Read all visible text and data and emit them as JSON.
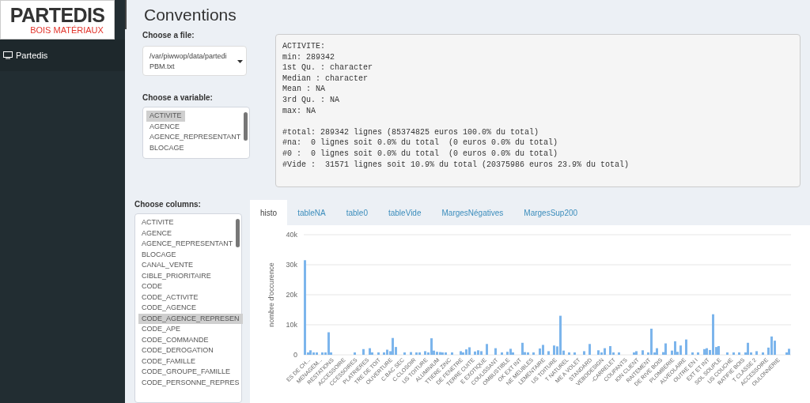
{
  "logo": {
    "brand": "PARTEDIS",
    "tagline": "BOIS MATÉRIAUX"
  },
  "sidebar": {
    "items": [
      {
        "label": "Partedis",
        "selected": true
      }
    ]
  },
  "page": {
    "title": "Conventions"
  },
  "file_select": {
    "label": "Choose a file:",
    "value_lines": [
      "/var/piwwop/data/partedi",
      "PBM.txt"
    ]
  },
  "variable_list": {
    "label": "Choose a variable:",
    "items": [
      {
        "label": "ACTIVITE",
        "selected": true
      },
      {
        "label": "AGENCE",
        "selected": false
      },
      {
        "label": "AGENCE_REPRESENTANT",
        "selected": false
      },
      {
        "label": "BLOCAGE",
        "selected": false
      }
    ]
  },
  "columns_list": {
    "label": "Choose columns:",
    "items": [
      {
        "label": "ACTIVITE",
        "selected": false
      },
      {
        "label": "AGENCE",
        "selected": false
      },
      {
        "label": "AGENCE_REPRESENTANT",
        "selected": false
      },
      {
        "label": "BLOCAGE",
        "selected": false
      },
      {
        "label": "CANAL_VENTE",
        "selected": false
      },
      {
        "label": "CIBLE_PRIORITAIRE",
        "selected": false
      },
      {
        "label": "CODE",
        "selected": false
      },
      {
        "label": "CODE_ACTIVITE",
        "selected": false
      },
      {
        "label": "CODE_AGENCE",
        "selected": false
      },
      {
        "label": "CODE_AGENCE_REPRESEN",
        "selected": true
      },
      {
        "label": "CODE_APE",
        "selected": false
      },
      {
        "label": "CODE_COMMANDE",
        "selected": false
      },
      {
        "label": "CODE_DEROGATION",
        "selected": false
      },
      {
        "label": "CODE_FAMILLE",
        "selected": false
      },
      {
        "label": "CODE_GROUPE_FAMILLE",
        "selected": false
      },
      {
        "label": "CODE_PERSONNE_REPRES",
        "selected": false
      }
    ]
  },
  "summary_output": {
    "stats": [
      "ACTIVITE:",
      "min: 289342",
      "1st Qu. : character",
      "Median : character",
      "Mean : NA",
      "3rd Qu. : NA",
      "max: NA"
    ],
    "totals": [
      "#total: 289342 lignes (85374825 euros 100.0% du total)",
      "#na:  0 lignes soit 0.0% du total  (0 euros 0.0% du total)",
      "#0 :  0 lignes soit 0.0% du total  (0 euros 0.0% du total)",
      "#Vide :  31571 lignes soit 10.9% du total (20375986 euros 23.9% du total)"
    ]
  },
  "tabs": [
    {
      "label": "histo",
      "selected": true
    },
    {
      "label": "tableNA",
      "selected": false
    },
    {
      "label": "table0",
      "selected": false
    },
    {
      "label": "tableVide",
      "selected": false
    },
    {
      "label": "MargesNégatives",
      "selected": false
    },
    {
      "label": "MargesSup200",
      "selected": false
    }
  ],
  "chart_data": {
    "type": "bar",
    "grid": true,
    "ylabel": "nombre d'occurence",
    "ylim": [
      0,
      40000
    ],
    "yticks": [
      {
        "value": 0,
        "label": "0"
      },
      {
        "value": 10000,
        "label": "10k"
      },
      {
        "value": 20000,
        "label": "20k"
      },
      {
        "value": 30000,
        "label": "30k"
      },
      {
        "value": 40000,
        "label": "40k"
      }
    ],
    "series": [
      {
        "color": "#7cb5ec",
        "values": [
          31500,
          800,
          1500,
          800,
          800,
          0,
          800,
          800,
          7500,
          800,
          0,
          0,
          0,
          0,
          0,
          0,
          0,
          800,
          0,
          0,
          1900,
          0,
          2200,
          800,
          0,
          800,
          0,
          800,
          1700,
          1200,
          5600,
          2600,
          0,
          0,
          800,
          0,
          900,
          0,
          800,
          800,
          0,
          1200,
          800,
          5500,
          1400,
          1000,
          900,
          800,
          800,
          0,
          800,
          0,
          0,
          1200,
          800,
          1800,
          2500,
          0,
          1100,
          1500,
          1200,
          0,
          3600,
          0,
          0,
          2200,
          0,
          800,
          0,
          1000,
          2000,
          800,
          0,
          0,
          4000,
          900,
          800,
          0,
          800,
          0,
          2100,
          3300,
          0,
          1200,
          0,
          3100,
          2800,
          13000,
          1400,
          0,
          800,
          0,
          800,
          0,
          0,
          1200,
          0,
          3600,
          0,
          0,
          1500,
          800,
          2200,
          0,
          2900,
          800,
          0,
          800,
          0,
          0,
          0,
          0,
          800,
          1200,
          0,
          1500,
          0,
          800,
          8700,
          800,
          2200,
          0,
          900,
          3800,
          0,
          1400,
          4500,
          1000,
          3100,
          0,
          5100,
          0,
          800,
          0,
          800,
          0,
          1900,
          2200,
          1600,
          13500,
          2600,
          2900,
          0,
          0,
          800,
          0,
          800,
          0,
          800,
          0,
          800,
          4000,
          800,
          0,
          1200,
          0,
          800,
          0,
          2400,
          6100,
          4700,
          0,
          0,
          0,
          800,
          2000
        ]
      }
    ],
    "categories": [
      null,
      "ES DE CH...",
      null,
      null,
      null,
      "MENAGEM...",
      null,
      null,
      null,
      "RESTATIONS",
      null,
      null,
      null,
      "ACCESSOIRE",
      null,
      null,
      null,
      "CCESSOIRES",
      null,
      null,
      null,
      "PLATRIERES",
      null,
      null,
      null,
      "TRE DE TOIT",
      null,
      null,
      null,
      "OUVERTURE",
      null,
      null,
      null,
      "C.BAC SEC",
      null,
      null,
      null,
      "C.CLOSOIR",
      null,
      null,
      null,
      "US TOITURE",
      null,
      null,
      null,
      "ALUMINIUM",
      null,
      null,
      null,
      "TTIERE ZINC",
      null,
      null,
      null,
      "DE FENETRE",
      null,
      null,
      null,
      "TERRE CUITE",
      null,
      null,
      null,
      "E EXOTIQUE",
      null,
      null,
      null,
      "COULISSANT",
      null,
      null,
      null,
      "OMBUSTIBLE",
      null,
      null,
      null,
      "OK EXT INT",
      null,
      null,
      null,
      "NE MEUBLES",
      null,
      null,
      null,
      "LEMENTAIRE",
      null,
      null,
      null,
      "US TOITURE",
      null,
      null,
      null,
      "T NATUREL",
      null,
      null,
      null,
      "ME A VOLET",
      null,
      null,
      null,
      "STANDARD",
      null,
      null,
      null,
      "VEBODESIGN",
      null,
      null,
      null,
      "-CARRELET",
      null,
      null,
      null,
      "COUPANTS",
      null,
      null,
      null,
      "ION CLIENT",
      null,
      null,
      null,
      "RAITEMENT",
      null,
      null,
      null,
      "DE RIVE BOIS",
      null,
      null,
      null,
      "PLOMBERIE",
      null,
      null,
      null,
      "ALVEOLAIRE",
      null,
      null,
      null,
      "OUTRE EN I",
      null,
      null,
      null,
      "EXT ET INT",
      null,
      null,
      null,
      "SOL SOUPLE",
      null,
      null,
      null,
      "US COUCHE",
      null,
      null,
      null,
      "RATIFIE BOIS",
      null,
      null,
      null,
      "T CLASSE 2",
      null,
      null,
      null,
      "ACCESSOIRE",
      null,
      null,
      null,
      "OULONNERIE",
      null,
      null,
      null,
      null
    ]
  }
}
